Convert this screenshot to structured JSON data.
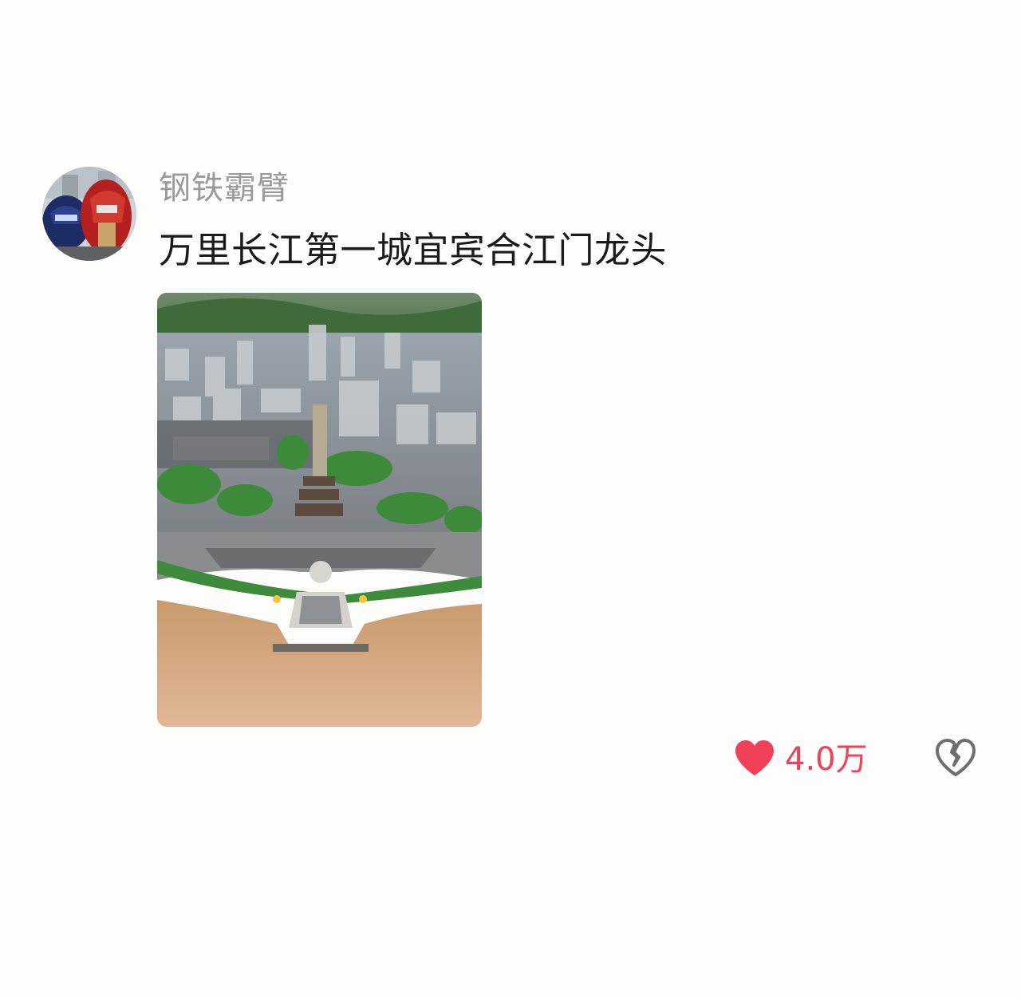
{
  "post": {
    "username": "钢铁霸臂",
    "text": "万里长江第一城宜宾合江门龙头",
    "likes": {
      "count": "4.0万",
      "icon": "heart-filled-icon",
      "color": "#f0405a"
    },
    "dislike": {
      "icon": "broken-heart-icon",
      "color": "#6e6e6e"
    },
    "avatar": {
      "icon": "user-avatar"
    }
  }
}
